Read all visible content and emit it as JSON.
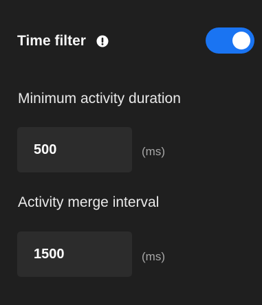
{
  "time_filter": {
    "title": "Time filter",
    "info_icon": "info-icon",
    "toggle": {
      "enabled": true,
      "accent_color": "#1a74f2"
    }
  },
  "minimum_activity_duration": {
    "label": "Minimum activity duration",
    "value": "500",
    "unit": "(ms)"
  },
  "activity_merge_interval": {
    "label": "Activity merge interval",
    "value": "1500",
    "unit": "(ms)"
  }
}
